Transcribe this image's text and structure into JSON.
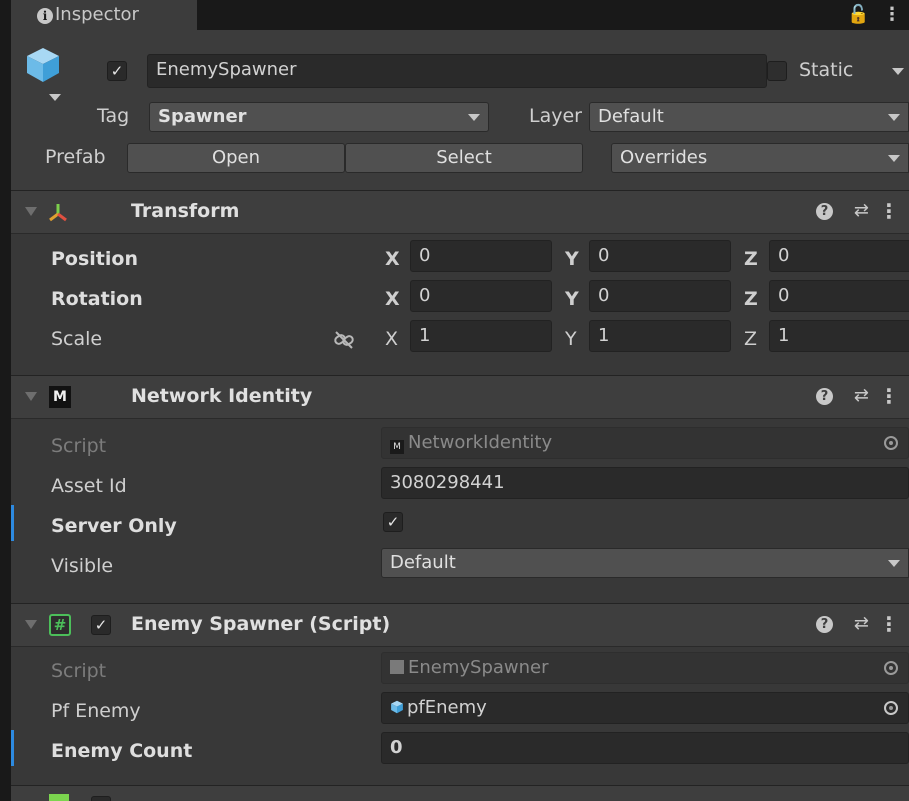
{
  "tab": {
    "title": "Inspector",
    "lock_icon": "lock-icon",
    "menu_icon": "kebab-menu-icon"
  },
  "gameobject": {
    "active": true,
    "name": "EnemySpawner",
    "static_label": "Static",
    "tag_label": "Tag",
    "tag_value": "Spawner",
    "layer_label": "Layer",
    "layer_value": "Default",
    "prefab_label": "Prefab",
    "prefab_open": "Open",
    "prefab_select": "Select",
    "prefab_overrides": "Overrides"
  },
  "transform": {
    "title": "Transform",
    "rows": [
      {
        "label": "Position",
        "x": "0",
        "y": "0",
        "z": "0"
      },
      {
        "label": "Rotation",
        "x": "0",
        "y": "0",
        "z": "0"
      },
      {
        "label": "Scale",
        "x": "1",
        "y": "1",
        "z": "1"
      }
    ],
    "axes": {
      "x": "X",
      "y": "Y",
      "z": "Z"
    }
  },
  "network_identity": {
    "title": "Network Identity",
    "script_label": "Script",
    "script_value": "NetworkIdentity",
    "asset_id_label": "Asset Id",
    "asset_id_value": "3080298441",
    "server_only_label": "Server Only",
    "server_only_checked": true,
    "visible_label": "Visible",
    "visible_value": "Default"
  },
  "enemy_spawner": {
    "title": "Enemy Spawner (Script)",
    "enabled": true,
    "script_label": "Script",
    "script_value": "EnemySpawner",
    "pf_enemy_label": "Pf Enemy",
    "pf_enemy_value": "pfEnemy",
    "enemy_count_label": "Enemy Count",
    "enemy_count_value": "0"
  },
  "colors": {
    "panel": "#383838",
    "field": "#2a2a2a",
    "accent": "#2d8ae0",
    "header": "#3e3e3e"
  }
}
